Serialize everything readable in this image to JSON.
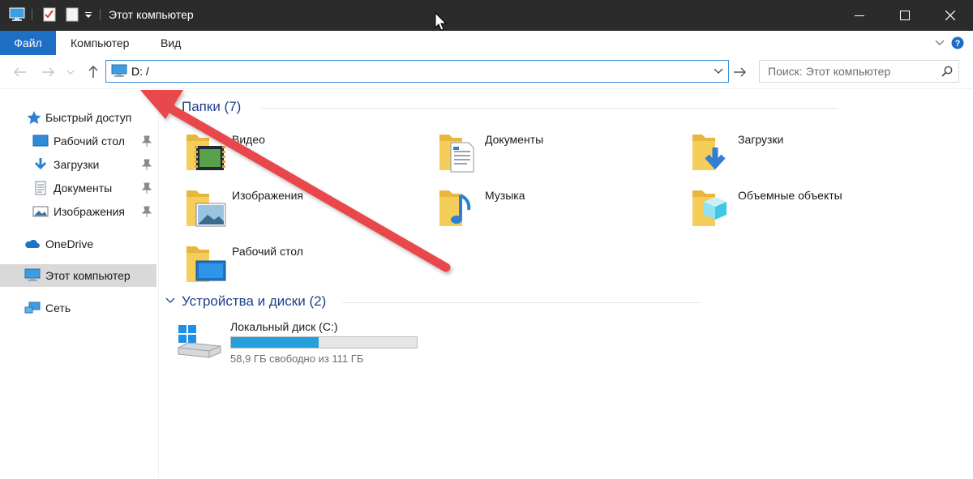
{
  "window": {
    "title": "Этот компьютер",
    "controls": [
      "minimize-icon",
      "maximize-icon",
      "close-icon"
    ]
  },
  "ribbon": {
    "tabs": [
      "Файл",
      "Компьютер",
      "Вид"
    ],
    "active_tab": "Файл",
    "active_color": "#1e6ec6"
  },
  "navigation": {
    "address_value": "D: /",
    "search_placeholder": "Поиск: Этот компьютер"
  },
  "sidebar": {
    "items": [
      {
        "label": "Быстрый доступ",
        "icon": "star-icon"
      },
      {
        "label": "Рабочий стол",
        "icon": "desktop-icon",
        "pinned": true
      },
      {
        "label": "Загрузки",
        "icon": "download-icon",
        "pinned": true
      },
      {
        "label": "Документы",
        "icon": "document-icon",
        "pinned": true
      },
      {
        "label": "Изображения",
        "icon": "pictures-icon",
        "pinned": true
      },
      {
        "label": "OneDrive",
        "icon": "cloud-icon"
      },
      {
        "label": "Этот компьютер",
        "icon": "computer-icon",
        "selected": true
      },
      {
        "label": "Сеть",
        "icon": "network-icon"
      }
    ]
  },
  "folders": {
    "title": "Папки (7)",
    "items": [
      {
        "label": "Видео",
        "icon": "video-folder-icon"
      },
      {
        "label": "Документы",
        "icon": "documents-folder-icon"
      },
      {
        "label": "Загрузки",
        "icon": "downloads-folder-icon"
      },
      {
        "label": "Изображения",
        "icon": "pictures-folder-icon"
      },
      {
        "label": "Музыка",
        "icon": "music-folder-icon"
      },
      {
        "label": "Объемные объекты",
        "icon": "3d-objects-folder-icon"
      },
      {
        "label": "Рабочий стол",
        "icon": "desktop-folder-icon"
      }
    ]
  },
  "devices": {
    "title": "Устройства и диски (2)",
    "drive": {
      "label": "Локальный диск (C:)",
      "subtitle": "58,9 ГБ свободно из 111 ГБ",
      "used_fraction": 0.47,
      "bar_color": "#26a0da"
    }
  },
  "annotation": {
    "arrow_color": "#e8474c"
  }
}
